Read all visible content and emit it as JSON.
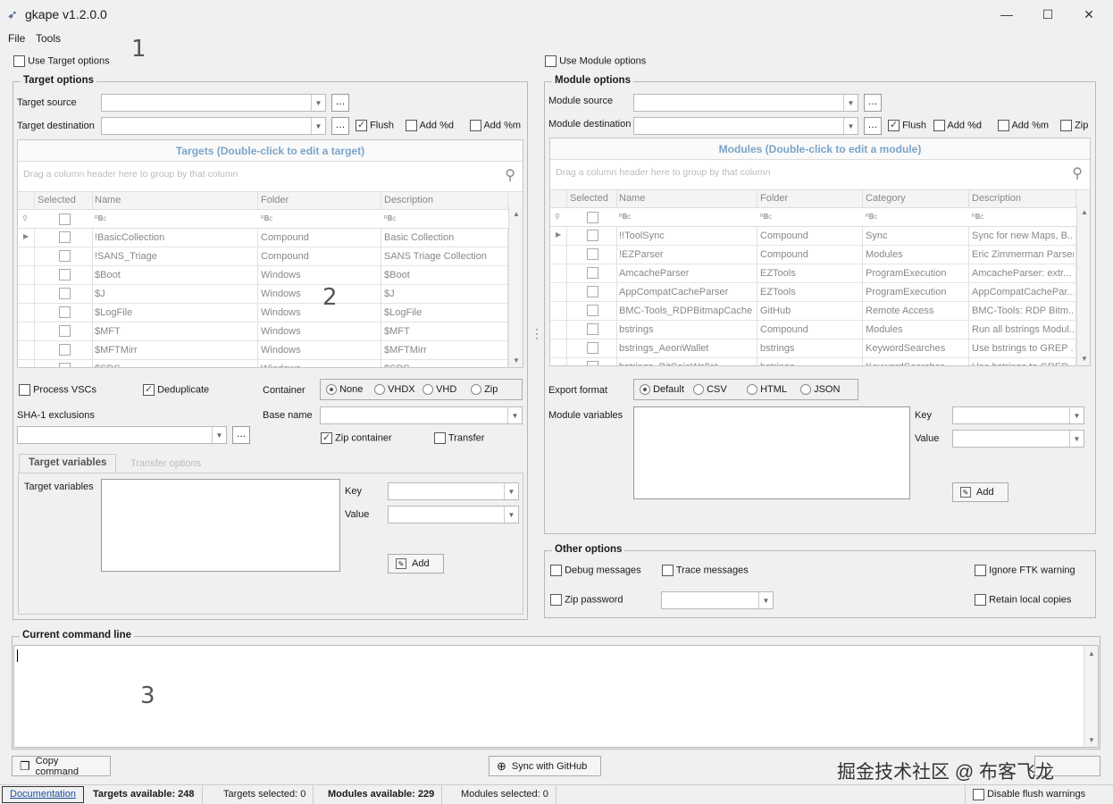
{
  "window": {
    "title": "gkape v1.2.0.0",
    "min_icon": "minimize-icon",
    "max_icon": "maximize-icon",
    "close_icon": "close-icon"
  },
  "menu": {
    "file": "File",
    "tools": "Tools"
  },
  "annotations": {
    "a1": "1",
    "a2": "2",
    "a3": "3"
  },
  "target": {
    "use_label": "Use Target options",
    "group_title": "Target options",
    "source_label": "Target source",
    "destination_label": "Target destination",
    "flush": "Flush",
    "add_d": "Add %d",
    "add_m": "Add %m",
    "grid_title": "Targets (Double-click to edit a target)",
    "group_hint": "Drag a column header here to group by that column",
    "columns": {
      "selected": "Selected",
      "name": "Name",
      "folder": "Folder",
      "description": "Description"
    },
    "filter_glyph": "ᴿ𝐁c",
    "rows": [
      {
        "name": "!BasicCollection",
        "folder": "Compound",
        "description": "Basic Collection"
      },
      {
        "name": "!SANS_Triage",
        "folder": "Compound",
        "description": "SANS Triage Collection"
      },
      {
        "name": "$Boot",
        "folder": "Windows",
        "description": "$Boot"
      },
      {
        "name": "$J",
        "folder": "Windows",
        "description": "$J"
      },
      {
        "name": "$LogFile",
        "folder": "Windows",
        "description": "$LogFile"
      },
      {
        "name": "$MFT",
        "folder": "Windows",
        "description": "$MFT"
      },
      {
        "name": "$MFTMirr",
        "folder": "Windows",
        "description": "$MFTMirr"
      },
      {
        "name": "$SDS",
        "folder": "Windows",
        "description": "$SDS"
      }
    ],
    "process_vscs": "Process VSCs",
    "deduplicate": "Deduplicate",
    "container_label": "Container",
    "container_opts": {
      "none": "None",
      "vhdx": "VHDX",
      "vhd": "VHD",
      "zip": "Zip"
    },
    "sha1_label": "SHA-1 exclusions",
    "base_name_label": "Base name",
    "zip_container": "Zip container",
    "transfer": "Transfer",
    "tab_vars": "Target variables",
    "tab_transfer": "Transfer options",
    "vars_label": "Target variables",
    "key_label": "Key",
    "value_label": "Value",
    "add_button": "Add"
  },
  "module": {
    "use_label": "Use Module options",
    "group_title": "Module options",
    "source_label": "Module source",
    "destination_label": "Module destination",
    "flush": "Flush",
    "add_d": "Add %d",
    "add_m": "Add %m",
    "zip": "Zip",
    "grid_title": "Modules (Double-click to edit a module)",
    "group_hint": "Drag a column header here to group by that column",
    "columns": {
      "selected": "Selected",
      "name": "Name",
      "folder": "Folder",
      "category": "Category",
      "description": "Description"
    },
    "rows": [
      {
        "name": "!!ToolSync",
        "folder": "Compound",
        "category": "Sync",
        "description": "Sync for new Maps, B..."
      },
      {
        "name": "!EZParser",
        "folder": "Compound",
        "category": "Modules",
        "description": "Eric Zimmerman Parsers"
      },
      {
        "name": "AmcacheParser",
        "folder": "EZTools",
        "category": "ProgramExecution",
        "description": "AmcacheParser: extr..."
      },
      {
        "name": "AppCompatCacheParser",
        "folder": "EZTools",
        "category": "ProgramExecution",
        "description": "AppCompatCachePar..."
      },
      {
        "name": "BMC-Tools_RDPBitmapCache...",
        "folder": "GitHub",
        "category": "Remote Access",
        "description": "BMC-Tools: RDP Bitm..."
      },
      {
        "name": "bstrings",
        "folder": "Compound",
        "category": "Modules",
        "description": "Run all bstrings Modul..."
      },
      {
        "name": "bstrings_AeonWallet",
        "folder": "bstrings",
        "category": "KeywordSearches",
        "description": "Use bstrings to GREP ..."
      },
      {
        "name": "bstrings_BitCoinWallet",
        "folder": "bstrings",
        "category": "KeywordSearches",
        "description": "Use bstrings to GREP ..."
      }
    ],
    "export_label": "Export format",
    "export_opts": {
      "default": "Default",
      "csv": "CSV",
      "html": "HTML",
      "json": "JSON"
    },
    "vars_label": "Module variables",
    "key_label": "Key",
    "value_label": "Value",
    "add_button": "Add"
  },
  "other": {
    "group_title": "Other options",
    "debug": "Debug messages",
    "trace": "Trace messages",
    "ignore_ftk": "Ignore FTK warning",
    "zip_password": "Zip password",
    "retain_local": "Retain local copies"
  },
  "cmdline": {
    "group_title": "Current command line"
  },
  "buttons": {
    "copy_command": "Copy command",
    "sync_github": "Sync with GitHub"
  },
  "watermark": "掘金技术社区 @ 布客飞龙",
  "status": {
    "documentation": "Documentation",
    "targets_available": "Targets available: 248",
    "targets_selected": "Targets selected: 0",
    "modules_available": "Modules available: 229",
    "modules_selected": "Modules selected: 0",
    "disable_flush": "Disable flush warnings"
  }
}
